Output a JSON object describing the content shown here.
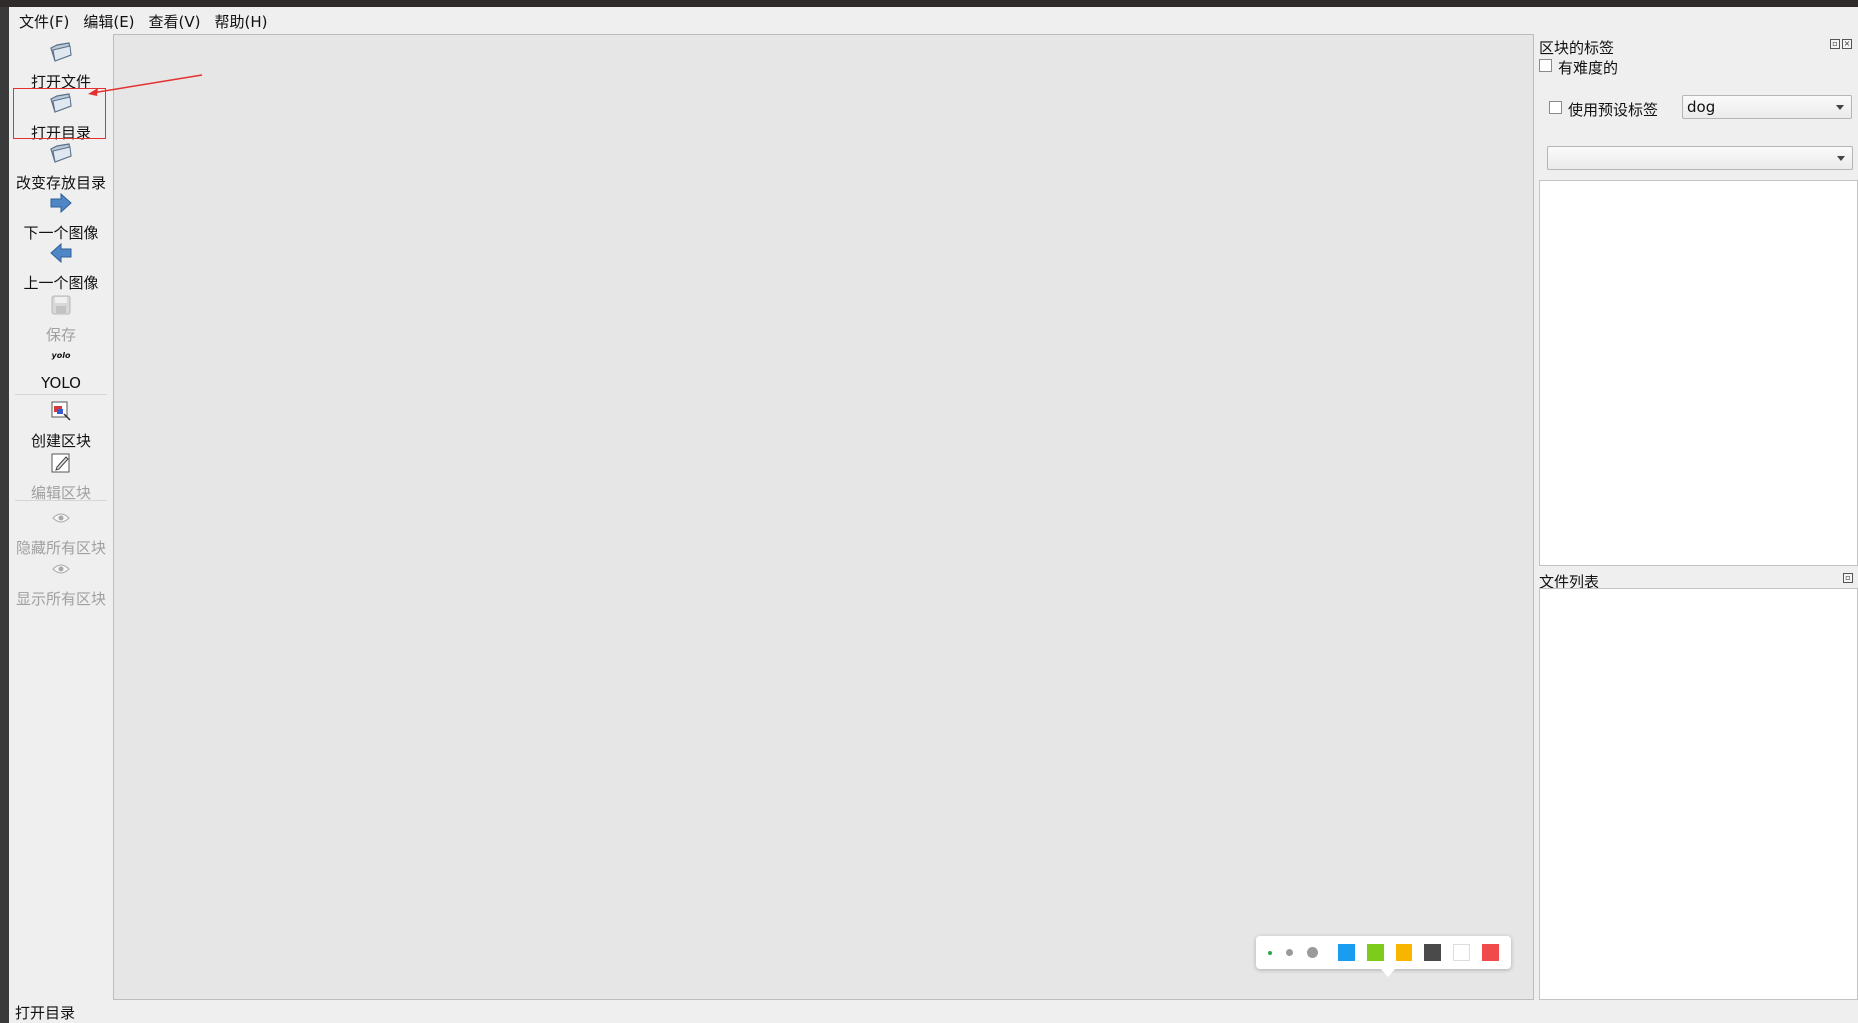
{
  "menu": {
    "file": "文件(F)",
    "edit": "编辑(E)",
    "view": "查看(V)",
    "help": "帮助(H)"
  },
  "toolbar": {
    "open_file": "打开文件",
    "open_dir": "打开目录",
    "change_save_dir": "改变存放目录",
    "next_image": "下一个图像",
    "prev_image": "上一个图像",
    "save": "保存",
    "yolo_icon_text": "yolo",
    "yolo": "YOLO",
    "create_box": "创建区块",
    "edit_box": "编辑区块",
    "hide_all": "隐藏所有区块",
    "show_all": "显示所有区块"
  },
  "dock": {
    "box_labels_title": "区块的标签",
    "difficult": "有难度的",
    "use_default_label": "使用预设标签",
    "default_label_value": "dog",
    "label_filter_value": "",
    "file_list_title": "文件列表"
  },
  "palette": {
    "colors": [
      "#1a9cf0",
      "#7ccc1c",
      "#f7b500",
      "#4a4a4a",
      "#ffffff",
      "#f04b4b"
    ]
  },
  "status": {
    "text": "打开目录"
  },
  "annotation": {
    "color": "#e53030"
  }
}
